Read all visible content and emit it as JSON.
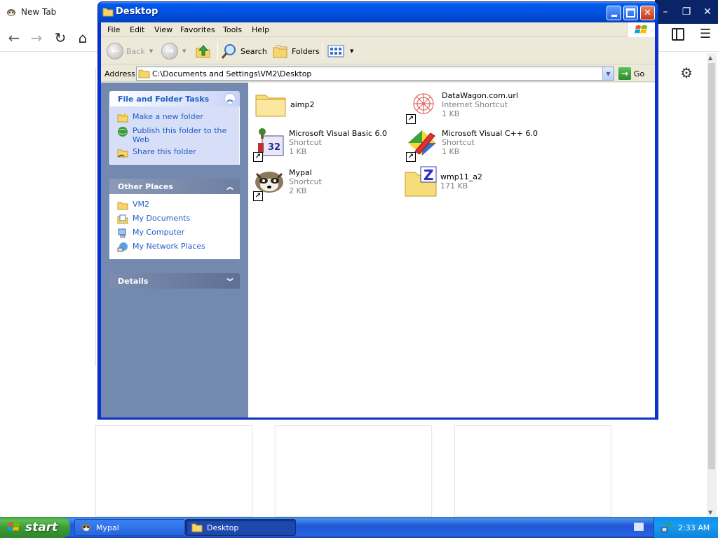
{
  "browser": {
    "tab_title": "New Tab",
    "menu_icon": "hamburger-icon",
    "settings_icon": "gear-icon"
  },
  "explorer": {
    "title": "Desktop",
    "menu": [
      "File",
      "Edit",
      "View",
      "Favorites",
      "Tools",
      "Help"
    ],
    "toolbar": {
      "back_label": "Back",
      "search_label": "Search",
      "folders_label": "Folders"
    },
    "address": {
      "label": "Address",
      "value": "C:\\Documents and Settings\\VM2\\Desktop",
      "go_label": "Go"
    },
    "tasks": {
      "title": "File and Folder Tasks",
      "items": [
        "Make a new folder",
        "Publish this folder to the Web",
        "Share this folder"
      ]
    },
    "places": {
      "title": "Other Places",
      "items": [
        "VM2",
        "My Documents",
        "My Computer",
        "My Network Places"
      ]
    },
    "details": {
      "title": "Details"
    },
    "files": [
      {
        "name": "aimp2",
        "type": "",
        "size": ""
      },
      {
        "name": "DataWagon.com.url",
        "type": "Internet Shortcut",
        "size": "1 KB"
      },
      {
        "name": "Microsoft Visual Basic 6.0",
        "type": "Shortcut",
        "size": "1 KB"
      },
      {
        "name": "Microsoft Visual C++ 6.0",
        "type": "Shortcut",
        "size": "1 KB"
      },
      {
        "name": "Mypal",
        "type": "Shortcut",
        "size": "2 KB"
      },
      {
        "name": "wmp11_a2",
        "type": "",
        "size": "171 KB"
      }
    ]
  },
  "taskbar": {
    "start_label": "start",
    "tasks": [
      "Mypal",
      "Desktop"
    ],
    "clock": "2:33 AM"
  },
  "colors": {
    "xp_blue": "#0054e3",
    "taskpane_link": "#215dc6",
    "start_green": "#3d9a37"
  }
}
